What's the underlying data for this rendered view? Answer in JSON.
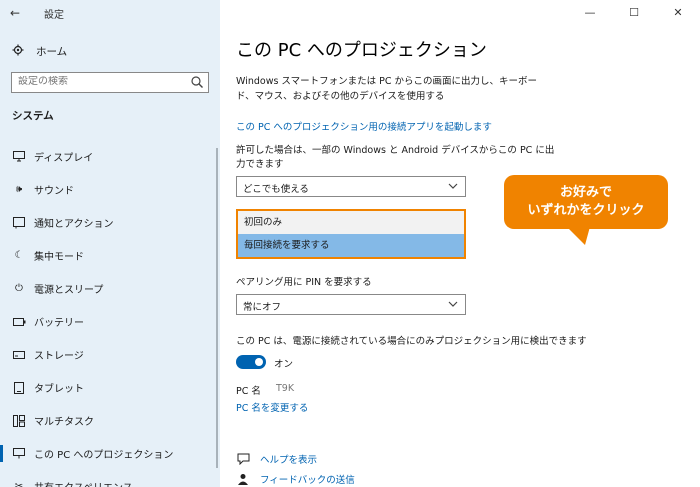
{
  "window": {
    "title": "設定",
    "controls": [
      "—",
      "☐",
      "✕"
    ]
  },
  "sidebar": {
    "home_label": "ホーム",
    "search_placeholder": "設定の検索",
    "section": "システム",
    "items": [
      {
        "label": "ディスプレイ",
        "icon": "display-icon"
      },
      {
        "label": "サウンド",
        "icon": "sound-icon"
      },
      {
        "label": "通知とアクション",
        "icon": "notification-icon"
      },
      {
        "label": "集中モード",
        "icon": "focus-icon"
      },
      {
        "label": "電源とスリープ",
        "icon": "power-icon"
      },
      {
        "label": "バッテリー",
        "icon": "battery-icon"
      },
      {
        "label": "ストレージ",
        "icon": "storage-icon"
      },
      {
        "label": "タブレット",
        "icon": "tablet-icon"
      },
      {
        "label": "マルチタスク",
        "icon": "multitask-icon"
      },
      {
        "label": "この PC へのプロジェクション",
        "icon": "projection-icon",
        "active": true
      },
      {
        "label": "共有エクスペリエンス",
        "icon": "share-icon"
      }
    ]
  },
  "main": {
    "title": "この PC へのプロジェクション",
    "description": "Windows スマートフォンまたは PC からこの画面に出力し、キーボード、マウス、およびその他のデバイスを使用する",
    "launch_link": "この PC へのプロジェクション用の接続アプリを起動します",
    "allow_label": "許可した場合は、一部の Windows と Android デバイスからこの PC に出力できます",
    "allow_value": "どこでも使える",
    "popup_options": [
      {
        "label": "初回のみ",
        "selected": false
      },
      {
        "label": "毎回接続を要求する",
        "selected": true
      }
    ],
    "pin_label": "ペアリング用に PIN を要求する",
    "pin_value": "常にオフ",
    "power_label": "この PC は、電源に接続されている場合にのみプロジェクション用に検出できます",
    "toggle_state": "オン",
    "pc_name_label": "PC 名",
    "pc_name_value": "T9K",
    "rename_link": "PC 名を変更する",
    "help_link": "ヘルプを表示",
    "feedback_link": "フィードバックの送信"
  },
  "callout": {
    "line1": "お好みで",
    "line2": "いずれかをクリック",
    "color": "#f08300"
  },
  "colors": {
    "accent": "#0063b1",
    "sidebar_bg": "#e6f0f8",
    "highlight": "#84b9e7"
  }
}
